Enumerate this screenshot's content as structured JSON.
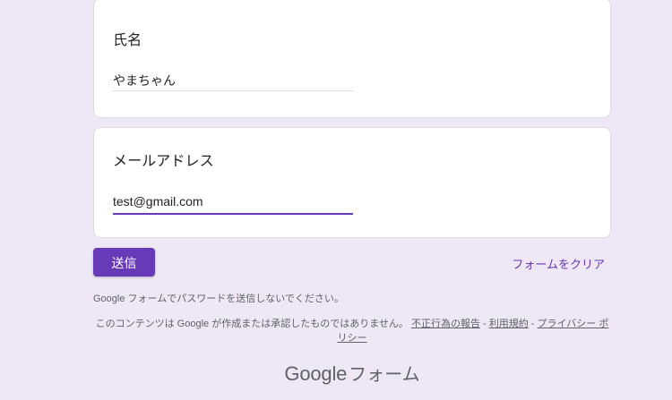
{
  "form": {
    "questions": [
      {
        "title": "氏名",
        "value": "やまちゃん"
      },
      {
        "title": "メールアドレス",
        "value": "test@gmail.com"
      }
    ],
    "submit_label": "送信",
    "clear_label": "フォームをクリア"
  },
  "footer": {
    "password_notice": "Google フォームでパスワードを送信しないでください。",
    "disclaimer_text": "このコンテンツは Google が作成または承認したものではありません。",
    "report_link": "不正行為の報告",
    "separator1": " - ",
    "terms_link": "利用規約",
    "separator2": " - ",
    "privacy_link": "プライバシー ポリシー",
    "brand_google": "Google",
    "brand_forms": "フォーム"
  },
  "colors": {
    "background": "#ede7f6",
    "accent": "#673ab7"
  }
}
